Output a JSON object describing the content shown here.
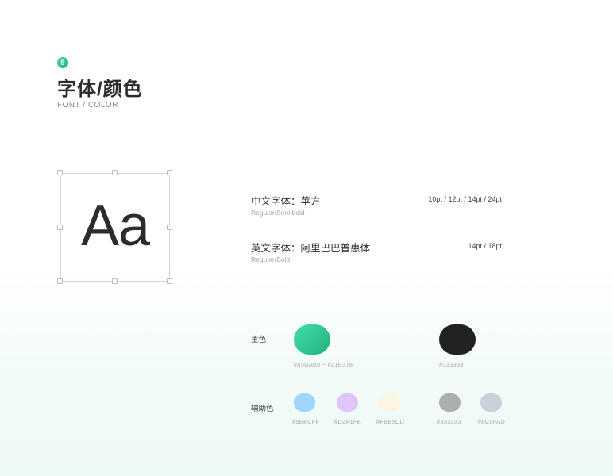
{
  "header": {
    "number": "9",
    "title": "字体/颜色",
    "subtitle": "FONT / COLOR"
  },
  "sample": {
    "glyphs": "Aa"
  },
  "fonts": [
    {
      "name": "中文字体：苹方",
      "weights": "Regular/Semibold",
      "sizes": "10pt / 12pt / 14pt / 24pt"
    },
    {
      "name": "英文字体：阿里巴巴普惠体",
      "weights": "Regular/Bold",
      "sizes": "14pt / 18pt"
    }
  ],
  "colors": {
    "primary_label": "主色",
    "primary": [
      {
        "hex_label": "#45DAB0 ~ #21B378",
        "from": "#45DAB0",
        "to": "#21B378"
      },
      {
        "hex_label": "#333333",
        "from": "#222222",
        "to": "#222222"
      }
    ],
    "secondary_label": "辅助色",
    "secondary": [
      {
        "hex_label": "#5EBCFF",
        "color": "#9FD6FA"
      },
      {
        "hex_label": "#D2A1FE",
        "color": "#E0C6FB"
      },
      {
        "hex_label": "#FBE5CD",
        "color": "#FBF5E4"
      },
      {
        "hex_label": "#333333",
        "color": "#ADAFAE"
      },
      {
        "hex_label": "#8C9FAD",
        "color": "#C9D2D8"
      }
    ]
  }
}
